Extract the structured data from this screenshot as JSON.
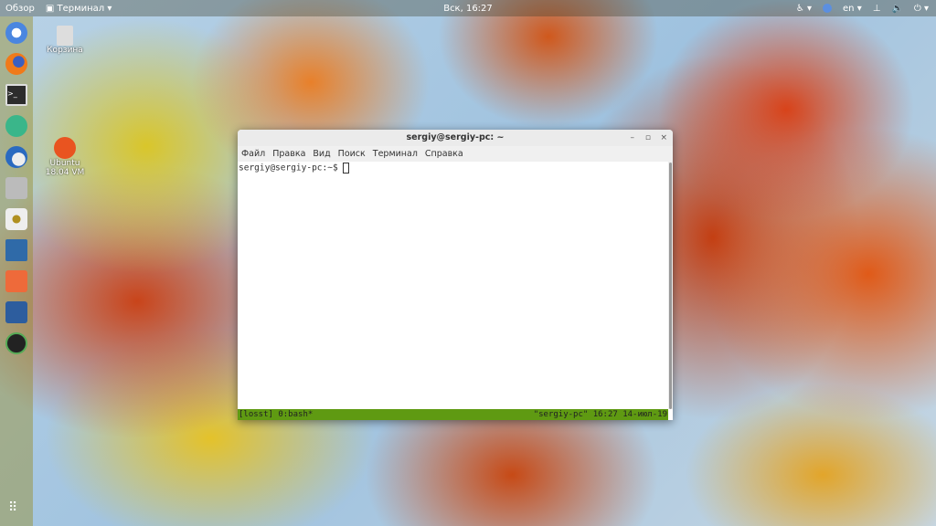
{
  "topbar": {
    "overview": "Обзор",
    "app": "Терминал",
    "clock": "Вск, 16:27",
    "lang": "en"
  },
  "desktop": {
    "trash": "Корзина",
    "ubuntu_line1": "Ubuntu",
    "ubuntu_line2": "18.04 VM"
  },
  "dock": [
    "chromium",
    "firefox",
    "terminal",
    "atom",
    "thunderbird",
    "files",
    "rhythmbox",
    "libreoffice-writer",
    "software-center",
    "virtualbox",
    "gimp"
  ],
  "window": {
    "title": "sergiy@sergiy-pc: ~",
    "menu": [
      "Файл",
      "Правка",
      "Вид",
      "Поиск",
      "Терминал",
      "Справка"
    ],
    "prompt": "sergiy@sergiy-pc:~$",
    "status_left": "[losst] 0:bash*",
    "status_right": "\"sergiy-pc\" 16:27 14-июл-19"
  },
  "colors": {
    "status": "#5f9a12"
  }
}
